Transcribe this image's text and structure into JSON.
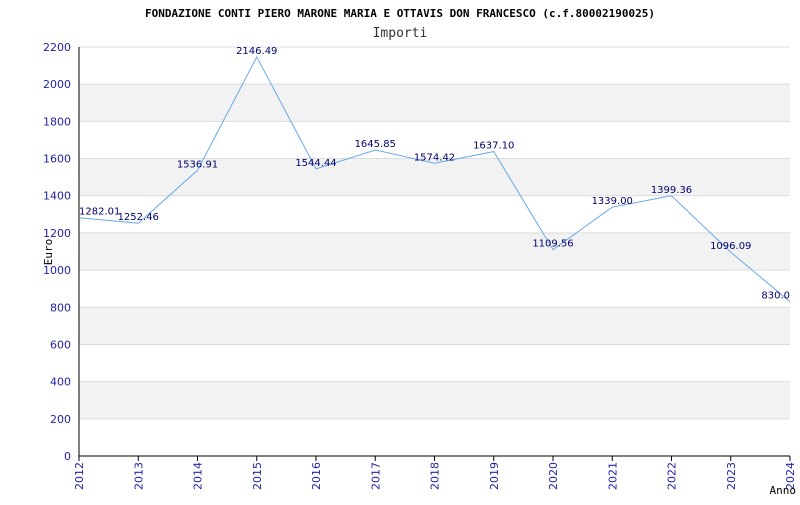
{
  "chart_data": {
    "type": "line",
    "title": "FONDAZIONE CONTI PIERO MARONE MARIA E OTTAVIS DON FRANCESCO (c.f.80002190025)",
    "subtitle": "Importi",
    "xlabel": "Anno",
    "ylabel": "Euro",
    "ylim": [
      0,
      2200
    ],
    "yticks": [
      0,
      200,
      400,
      600,
      800,
      1000,
      1200,
      1400,
      1600,
      1800,
      2000,
      2200
    ],
    "grid": true,
    "categories": [
      "2012",
      "2013",
      "2014",
      "2015",
      "2016",
      "2017",
      "2018",
      "2019",
      "2020",
      "2021",
      "2022",
      "2023",
      "2024"
    ],
    "series": [
      {
        "values": [
          1282.01,
          1252.46,
          1536.91,
          2146.49,
          1544.44,
          1645.85,
          1574.42,
          1637.1,
          1109.56,
          1339.0,
          1399.36,
          1096.09,
          830.0
        ],
        "labels": [
          "1282.01",
          "1252.46",
          "1536.91",
          "2146.49",
          "1544.44",
          "1645.85",
          "1574.42",
          "1637.10",
          "1109.56",
          "1339.00",
          "1399.36",
          "1096.09",
          "830.0"
        ]
      }
    ],
    "colors": {
      "line": "#6aa8e8",
      "band": "#f2f2f2",
      "gridline": "#dcdcdc",
      "tick_text": "#1f1fa8",
      "label_text": "#00006e"
    }
  }
}
